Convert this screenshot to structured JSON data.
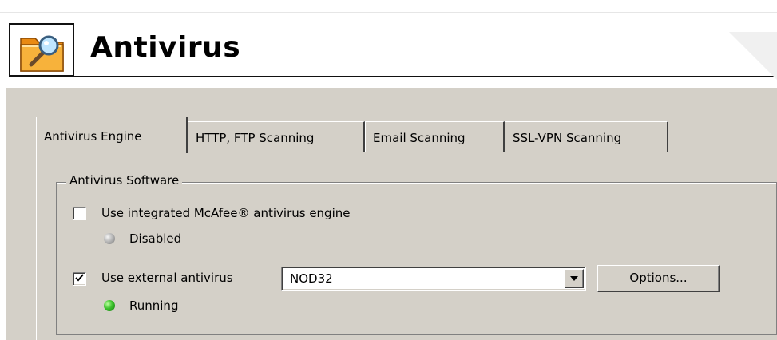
{
  "header": {
    "title": "Antivirus",
    "icon": "folder-search-icon"
  },
  "tabs": [
    {
      "label": "Antivirus Engine",
      "active": true
    },
    {
      "label": "HTTP, FTP Scanning",
      "active": false
    },
    {
      "label": "Email Scanning",
      "active": false
    },
    {
      "label": "SSL-VPN Scanning",
      "active": false
    }
  ],
  "antivirus_software": {
    "group_label": "Antivirus Software",
    "integrated": {
      "label": "Use integrated McAfee® antivirus engine",
      "checked": false,
      "status": "Disabled",
      "status_color": "#a0a0a0"
    },
    "external": {
      "label": "Use external antivirus",
      "checked": true,
      "selected": "NOD32",
      "status": "Running",
      "status_color": "#2fb82a"
    },
    "options_button": "Options..."
  }
}
